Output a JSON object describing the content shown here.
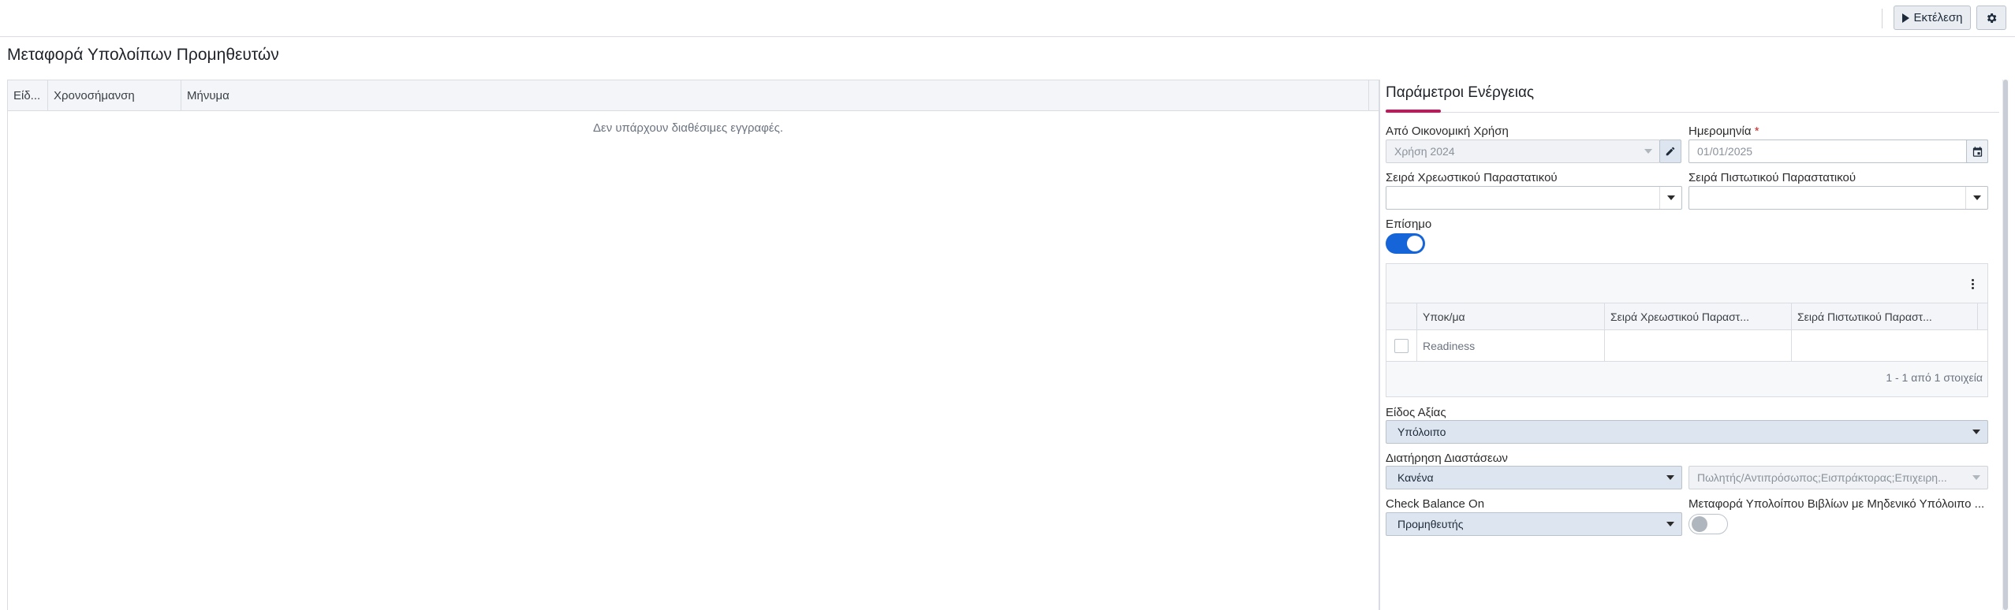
{
  "toolbar": {
    "run_label": "Εκτέλεση",
    "run_icon": "play-icon",
    "settings_icon": "gear-icon"
  },
  "page": {
    "title": "Μεταφορά Υπολοίπων Προμηθευτών"
  },
  "log_grid": {
    "columns": [
      "Είδ...",
      "Χρονοσήμανση",
      "Μήνυμα"
    ],
    "empty_message": "Δεν υπάρχουν διαθέσιμες εγγραφές."
  },
  "params": {
    "title": "Παράμετροι Ενέργειας",
    "accent_color": "#c2185b",
    "from_fiscal_year": {
      "label": "Από Οικονομική Χρήση",
      "value": "Χρήση 2024"
    },
    "date": {
      "label": "Ημερομηνία",
      "required_mark": "*",
      "value": "01/01/2025"
    },
    "debit_series": {
      "label": "Σειρά Χρεωστικού Παραστατικού",
      "value": ""
    },
    "credit_series": {
      "label": "Σειρά Πιστωτικού Παραστατικού",
      "value": ""
    },
    "official": {
      "label": "Επίσημο",
      "checked": true
    },
    "branch_grid": {
      "columns": [
        "Υποκ/μα",
        "Σειρά Χρεωστικού Παραστ...",
        "Σειρά Πιστωτικού Παραστ..."
      ],
      "rows": [
        {
          "branch": "Readiness",
          "debit": "",
          "credit": ""
        }
      ],
      "footer": "1 - 1 από 1 στοιχεία"
    },
    "value_type": {
      "label": "Είδος Αξίας",
      "value": "Υπόλοιπο"
    },
    "keep_dimensions": {
      "label": "Διατήρηση Διαστάσεων",
      "value": "Κανένα",
      "detail_value": "Πωλητής/Αντιπρόσωπος;Εισπράκτορας;Επιχειρη..."
    },
    "check_balance_on": {
      "label": "Check Balance On",
      "value": "Προμηθευτής"
    },
    "transfer_zero_balance": {
      "label": "Μεταφορά Υπολοίπου Βιβλίων με Μηδενικό Υπόλοιπο ...",
      "checked": false
    }
  }
}
